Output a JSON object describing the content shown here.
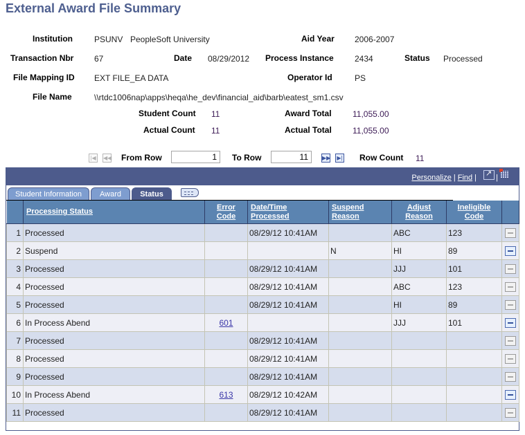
{
  "page": {
    "title": "External Award File Summary"
  },
  "summary": {
    "institution_label": "Institution",
    "institution_code": "PSUNV",
    "institution_name": "PeopleSoft University",
    "aid_year_label": "Aid Year",
    "aid_year": "2006-2007",
    "transaction_nbr_label": "Transaction Nbr",
    "transaction_nbr": "67",
    "date_label": "Date",
    "date": "08/29/2012",
    "process_instance_label": "Process Instance",
    "process_instance": "2434",
    "status_label": "Status",
    "status": "Processed",
    "file_mapping_id_label": "File Mapping ID",
    "file_mapping_id": "EXT FILE_EA DATA",
    "operator_id_label": "Operator Id",
    "operator_id": "PS",
    "file_name_label": "File Name",
    "file_name": "\\\\rtdc1006nap\\apps\\heqa\\he_dev\\financial_aid\\barb\\eatest_sm1.csv",
    "student_count_label": "Student Count",
    "student_count": "11",
    "award_total_label": "Award Total",
    "award_total": "11,055.00",
    "actual_count_label": "Actual Count",
    "actual_count": "11",
    "actual_total_label": "Actual Total",
    "actual_total": "11,055.00"
  },
  "row_nav": {
    "from_row_label": "From Row",
    "from_row": "1",
    "to_row_label": "To Row",
    "to_row": "11",
    "row_count_label": "Row Count",
    "row_count": "11"
  },
  "grid": {
    "personalize_label": "Personalize",
    "find_label": "Find",
    "tabs": [
      {
        "label": "Student Information",
        "active": false
      },
      {
        "label": "Award",
        "active": false
      },
      {
        "label": "Status",
        "active": true
      }
    ],
    "columns": {
      "processing_status": "Processing Status",
      "error_code_1": "Error",
      "error_code_2": "Code",
      "datetime_1": "Date/Time",
      "datetime_2": "Processed",
      "suspend_1": "Suspend",
      "suspend_2": "Reason",
      "adjust_1": "Adjust",
      "adjust_2": "Reason",
      "inelig_1": "Ineligible",
      "inelig_2": "Code"
    },
    "rows": [
      {
        "num": "1",
        "status": "Processed",
        "error_code": "",
        "datetime": "08/29/12 10:41AM",
        "suspend": "",
        "adjust": "ABC",
        "ineligible": "123",
        "delete_enabled": false
      },
      {
        "num": "2",
        "status": "Suspend",
        "error_code": "",
        "datetime": "",
        "suspend": "N",
        "adjust": "HI",
        "ineligible": "89",
        "delete_enabled": true
      },
      {
        "num": "3",
        "status": "Processed",
        "error_code": "",
        "datetime": "08/29/12 10:41AM",
        "suspend": "",
        "adjust": "JJJ",
        "ineligible": "101",
        "delete_enabled": false
      },
      {
        "num": "4",
        "status": "Processed",
        "error_code": "",
        "datetime": "08/29/12 10:41AM",
        "suspend": "",
        "adjust": "ABC",
        "ineligible": "123",
        "delete_enabled": false
      },
      {
        "num": "5",
        "status": "Processed",
        "error_code": "",
        "datetime": "08/29/12 10:41AM",
        "suspend": "",
        "adjust": "HI",
        "ineligible": "89",
        "delete_enabled": false
      },
      {
        "num": "6",
        "status": "In Process Abend",
        "error_code": "601",
        "datetime": "",
        "suspend": "",
        "adjust": "JJJ",
        "ineligible": "101",
        "delete_enabled": true
      },
      {
        "num": "7",
        "status": "Processed",
        "error_code": "",
        "datetime": "08/29/12 10:41AM",
        "suspend": "",
        "adjust": "",
        "ineligible": "",
        "delete_enabled": false
      },
      {
        "num": "8",
        "status": "Processed",
        "error_code": "",
        "datetime": "08/29/12 10:41AM",
        "suspend": "",
        "adjust": "",
        "ineligible": "",
        "delete_enabled": false
      },
      {
        "num": "9",
        "status": "Processed",
        "error_code": "",
        "datetime": "08/29/12 10:41AM",
        "suspend": "",
        "adjust": "",
        "ineligible": "",
        "delete_enabled": false
      },
      {
        "num": "10",
        "status": "In Process Abend",
        "error_code": "613",
        "datetime": "08/29/12 10:42AM",
        "suspend": "",
        "adjust": "",
        "ineligible": "",
        "delete_enabled": true
      },
      {
        "num": "11",
        "status": "Processed",
        "error_code": "",
        "datetime": "08/29/12 10:41AM",
        "suspend": "",
        "adjust": "",
        "ineligible": "",
        "delete_enabled": false
      }
    ]
  }
}
